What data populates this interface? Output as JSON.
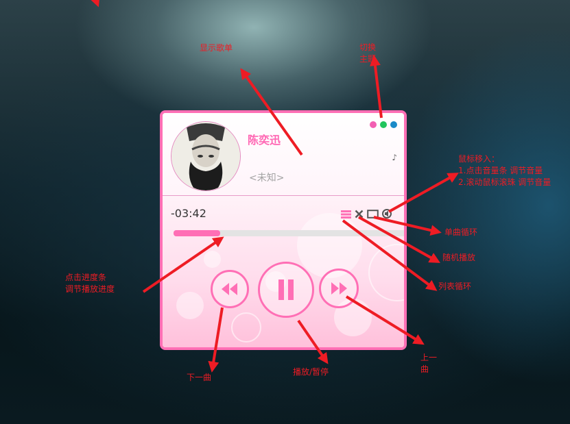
{
  "player": {
    "title": "陈奕迅",
    "artist": "<未知>",
    "lyric_mark": "♪",
    "time_remaining": "-03:42",
    "progress": 0.2,
    "theme_dot_colors": [
      "#f25fb2",
      "#21c55d",
      "#1a8bc8"
    ],
    "accent_color": "#ff6fb5"
  },
  "annotations": {
    "show_playlist": "显示歌单",
    "switch_theme": [
      "切换",
      "主题"
    ],
    "volume_hover": [
      "鼠标移入：",
      "1.点击音量条 调节音量",
      "2.滚动鼠标滚珠 调节音量"
    ],
    "single_loop": "单曲循环",
    "random_play": "随机播放",
    "list_loop": "列表循环",
    "seek": [
      "点击进度条",
      "调节播放进度"
    ],
    "next_song": "下一曲",
    "play_pause": "播放/暂停",
    "prev_song": [
      "上一",
      "曲"
    ]
  }
}
